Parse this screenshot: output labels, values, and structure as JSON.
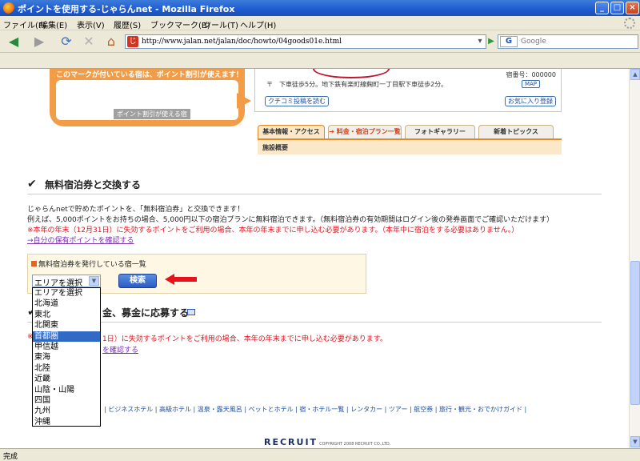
{
  "window": {
    "title": "ポイントを使用する-じゃらんnet - Mozilla Firefox",
    "minimize": "_",
    "maximize": "□",
    "close": "×"
  },
  "menu": [
    "ファイル(F)",
    "編集(E)",
    "表示(V)",
    "履歴(S)",
    "ブックマーク(B)",
    "ツール(T)",
    "ヘルプ(H)"
  ],
  "nav": {
    "back": "◀",
    "forward": "▶",
    "reload": "⟳",
    "stop": "✕",
    "home": "⌂",
    "url": "http://www.jalan.net/jalan/doc/howto/04goods01e.html",
    "search_engine": "G",
    "search_placeholder": "Google"
  },
  "background": {
    "point_banner": "このマークが付いている宿は、ポイント割引が使えます！",
    "point_tag": "ポイント割引が使える宿",
    "address": "〒　下車徒歩5分。地下鉄有楽町線麹町一丁目駅下車徒歩2分。",
    "hotel_no": "宿番号：000000",
    "map_btn": "MAP",
    "kuchikomi_btn": "クチコミ投稿を読む",
    "favorite_btn": "お気に入り登録",
    "tabs": [
      "基本情報・アクセス",
      "➔ 料金・宿泊プラン一覧",
      "フォトギャラリー",
      "新着トピックス"
    ],
    "tab_sub": "施設概要"
  },
  "section1": {
    "checkmark": "✔",
    "title": "無料宿泊券と交換する",
    "line1": "じゃらんnetで貯めたポイントを、「無料宿泊券」と交換できます！",
    "line2": "例えば、5,000ポイントをお持ちの場合、5,000円以下の宿泊プランに無料宿泊できます。（無料宿泊券の有効期間はログイン後の発券画面でご確認いただけます）",
    "red_note": "※本年の年末（12月31日）に失効するポイントをご利用の場合、本年の年末までに申し込む必要があります。（本年中に宿泊をする必要はありません。）",
    "link": "→自分の保有ポイントを確認する",
    "hotel_list_header": "無料宿泊券を発行している宿一覧",
    "select_value": "エリアを選択",
    "search_button": "検索"
  },
  "section2": {
    "title_tail": "金、募金に応募する",
    "red_note_tail": "1日）に失効するポイントをご利用の場合、本年の年末までに申し込む必要があります。",
    "link_tail": "を確認する",
    "red_note_lead": "※"
  },
  "dropdown": {
    "options": [
      "エリアを選択",
      "北海道",
      "東北",
      "北関東",
      "首都圏",
      "甲信越",
      "東海",
      "北陸",
      "近畿",
      "山陰・山陽",
      "四国",
      "九州",
      "沖縄"
    ],
    "selected_index": 4
  },
  "footer": {
    "links": "| ビジネスホテル | 高級ホテル | 温泉・露天風呂 | ペットとホテル | 宿・ホテル一覧 | レンタカー | ツアー | 航空券 | 旅行・観光・おでかけガイド |",
    "brand": "RECRUIT",
    "copyright": "COPYRIGHT 2008 RECRUIT CO.,LTD."
  },
  "status": "完成"
}
